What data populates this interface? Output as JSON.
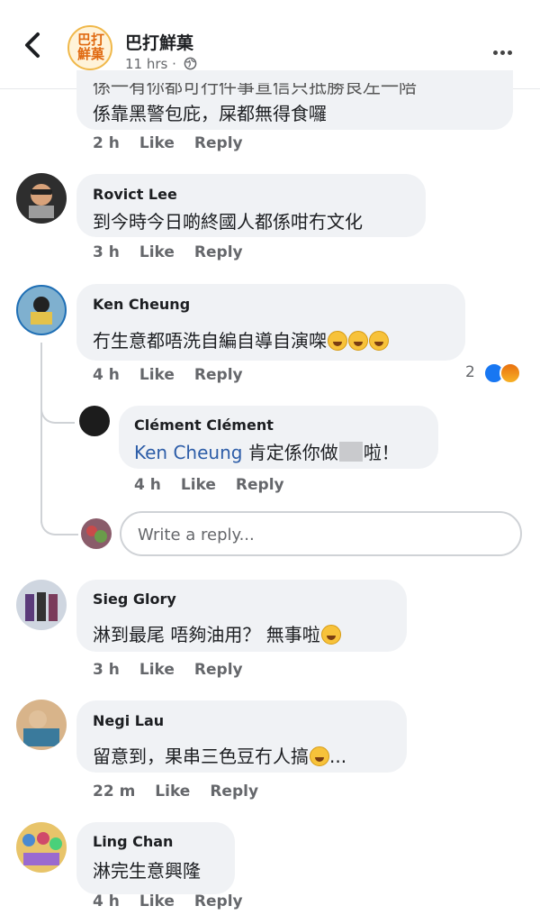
{
  "header": {
    "page_name": "巴打鮮菓",
    "logo_line1": "巴打",
    "logo_line2": "鮮菓",
    "post_time": "11 hrs ·"
  },
  "actions": {
    "like": "Like",
    "reply": "Reply"
  },
  "comments": [
    {
      "text_line1": "係一有你都可行件事宣信只抵勝良左一陪",
      "text_line2": "係靠黑警包庇，屎都無得食囉",
      "time": "2 h"
    },
    {
      "author": "Rovict Lee",
      "text": "到今時今日啲終國人都係咁冇文化",
      "time": "3 h"
    },
    {
      "author": "Ken Cheung",
      "text": "冇生意都唔洗自編自導自演㗎",
      "emoji": "rolling-laughing-emoji",
      "time": "4 h",
      "reaction_count": "2",
      "reply": {
        "author": "Clément Clément",
        "mention": "Ken Cheung",
        "text_a": "肯定係你做",
        "text_b": "啦！",
        "time": "4 h"
      }
    },
    {
      "author": "Sieg Glory",
      "text": "淋到最尾 唔夠油用？ 無事啦",
      "time": "3 h"
    },
    {
      "author": "Negi Lau",
      "text": "留意到，果串三色豆冇人搞",
      "text_tail": "...",
      "time": "22 m"
    },
    {
      "author": "Ling Chan",
      "text": "淋完生意興隆",
      "time": "4 h"
    }
  ],
  "reply_box": {
    "placeholder": "Write a reply..."
  },
  "icons": {
    "back": "chevron-left-icon",
    "privacy": "globe-icon",
    "more": "more-dots-icon"
  },
  "colors": {
    "bubble": "#f0f2f5",
    "mention": "#2d5da8",
    "like_blue": "#1877f2",
    "meta_gray": "#65676b"
  }
}
